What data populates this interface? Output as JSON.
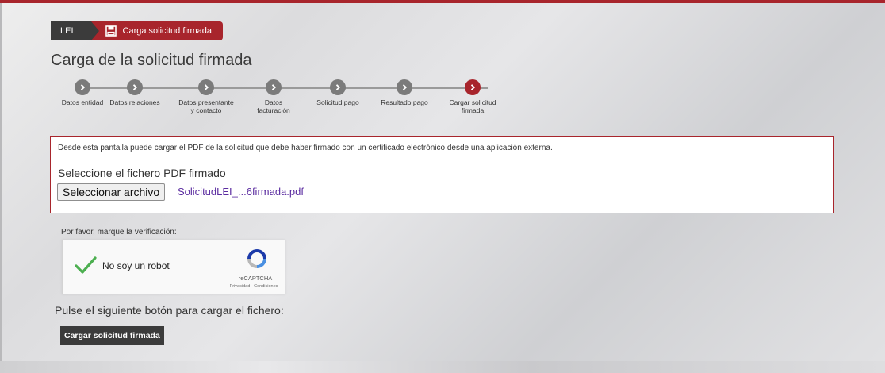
{
  "breadcrumb": {
    "items": [
      {
        "label": "LEI",
        "icon": ""
      },
      {
        "label": "Carga solicitud firmada",
        "icon": "floppy-disk-icon"
      }
    ]
  },
  "page": {
    "title": "Carga de la solicitud firmada"
  },
  "steps": [
    {
      "label": "Datos entidad",
      "state": "completed"
    },
    {
      "label": "Datos relaciones",
      "state": "completed"
    },
    {
      "label": "Datos presentante y contacto",
      "state": "completed"
    },
    {
      "label": "Datos facturación",
      "state": "completed"
    },
    {
      "label": "Solicitud pago",
      "state": "completed"
    },
    {
      "label": "Resultado pago",
      "state": "completed"
    },
    {
      "label": "Cargar solicitud firmada",
      "state": "active"
    }
  ],
  "upload": {
    "info": "Desde esta pantalla puede cargar el PDF de la solicitud que debe haber firmado con un certificado electrónico desde una aplicación externa.",
    "file_label": "Seleccione el fichero PDF firmado",
    "button_label": "Seleccionar archivo",
    "file_name": "SolicitudLEI_...6firmada.pdf"
  },
  "verification": {
    "label": "Por favor, marque la verificación:",
    "checkbox_label": "No soy un robot",
    "brand": "reCAPTCHA",
    "links": "Privacidad - Condiciones",
    "checked": true
  },
  "submit": {
    "instruction": "Pulse el siguiente botón para cargar el fichero:",
    "button_label": "Cargar solicitud firmada"
  },
  "colors": {
    "accent": "#a8252c",
    "dark": "#3b3b3b",
    "step_done": "#7b7b7b",
    "link": "#5b2ca0",
    "check": "#4caf50"
  }
}
